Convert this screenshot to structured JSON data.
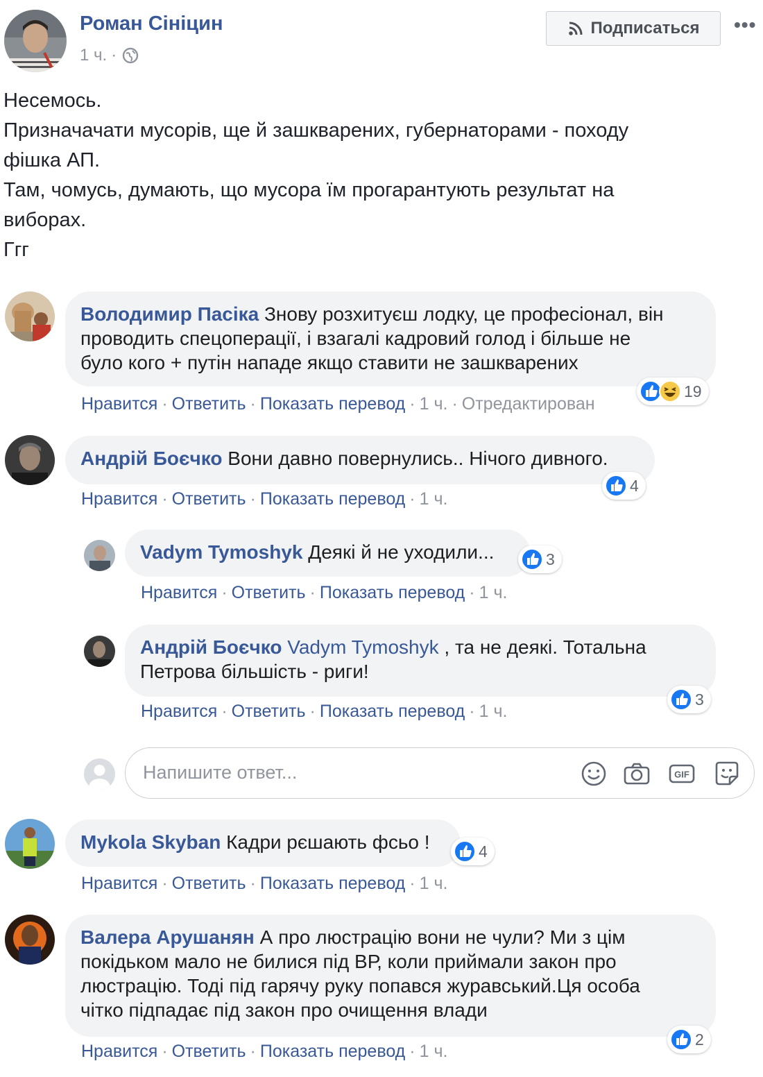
{
  "post": {
    "author": "Роман Сініцин",
    "time": "1 ч.",
    "separator": "·",
    "subscribe_label": "Подписаться",
    "more_label": "•••",
    "body_lines": [
      "Несемось.",
      "Призначачати мусорів, ще й зашкварених, губернаторами - походу",
      "фішка АП.",
      "Там, чомусь, думають, що мусора їм прогарантують результат на",
      "виборах.",
      "Ггг"
    ]
  },
  "action_labels": {
    "like": "Нравится",
    "reply": "Ответить",
    "translate": "Показать перевод",
    "edited": "Отредактирован"
  },
  "comments": [
    {
      "name": "Володимир Пасіка",
      "text_lines": [
        "Знову розхитуєш лодку, це професіонал, він",
        "проводить спецоперації, і взагалі кадровий голод і більше не",
        "було кого + путін нападе якщо ставити не зашкварених"
      ],
      "time": "1 ч.",
      "reactions": "19",
      "reaction_types": [
        "like-icon",
        "haha-icon"
      ]
    },
    {
      "name": "Андрій Боєчко",
      "text": "Вони давно повернулись.. Нічого дивного.",
      "time": "1 ч.",
      "reactions": "4"
    },
    {
      "name": "Vadym Tymoshyk",
      "text": "Деякі й не уходили...",
      "time": "1 ч.",
      "reactions": "3"
    },
    {
      "name": "Андрій Боєчко",
      "mention": "Vadym Tymoshyk",
      "text_lines": [
        ", та не деякі. Тотальна",
        "Петрова більшість - риги!"
      ],
      "time": "1 ч.",
      "reactions": "3"
    },
    {
      "name": "Mykola Skyban",
      "text": "Кадри рєшають фсьо !",
      "time": "1 ч.",
      "reactions": "4"
    },
    {
      "name": "Валера Арушанян",
      "text_lines": [
        "А про люстрацію вони не чули? Ми з цім",
        "покідьком мало не билися під ВР, коли приймали закон про",
        "люстрацію. Тоді під гарячу руку попався журавський.Ця особа",
        "чітко підпадає під закон про очищення влади"
      ],
      "time": "1 ч.",
      "reactions": "2"
    }
  ],
  "reply_box": {
    "placeholder": "Напишите ответ...",
    "icons": [
      "emoji-icon",
      "camera-icon",
      "gif-icon",
      "sticker-icon"
    ]
  },
  "colors": {
    "link": "#385898",
    "muted": "#90949c",
    "bubble": "#f2f3f5",
    "like_blue": "#1877f2"
  }
}
